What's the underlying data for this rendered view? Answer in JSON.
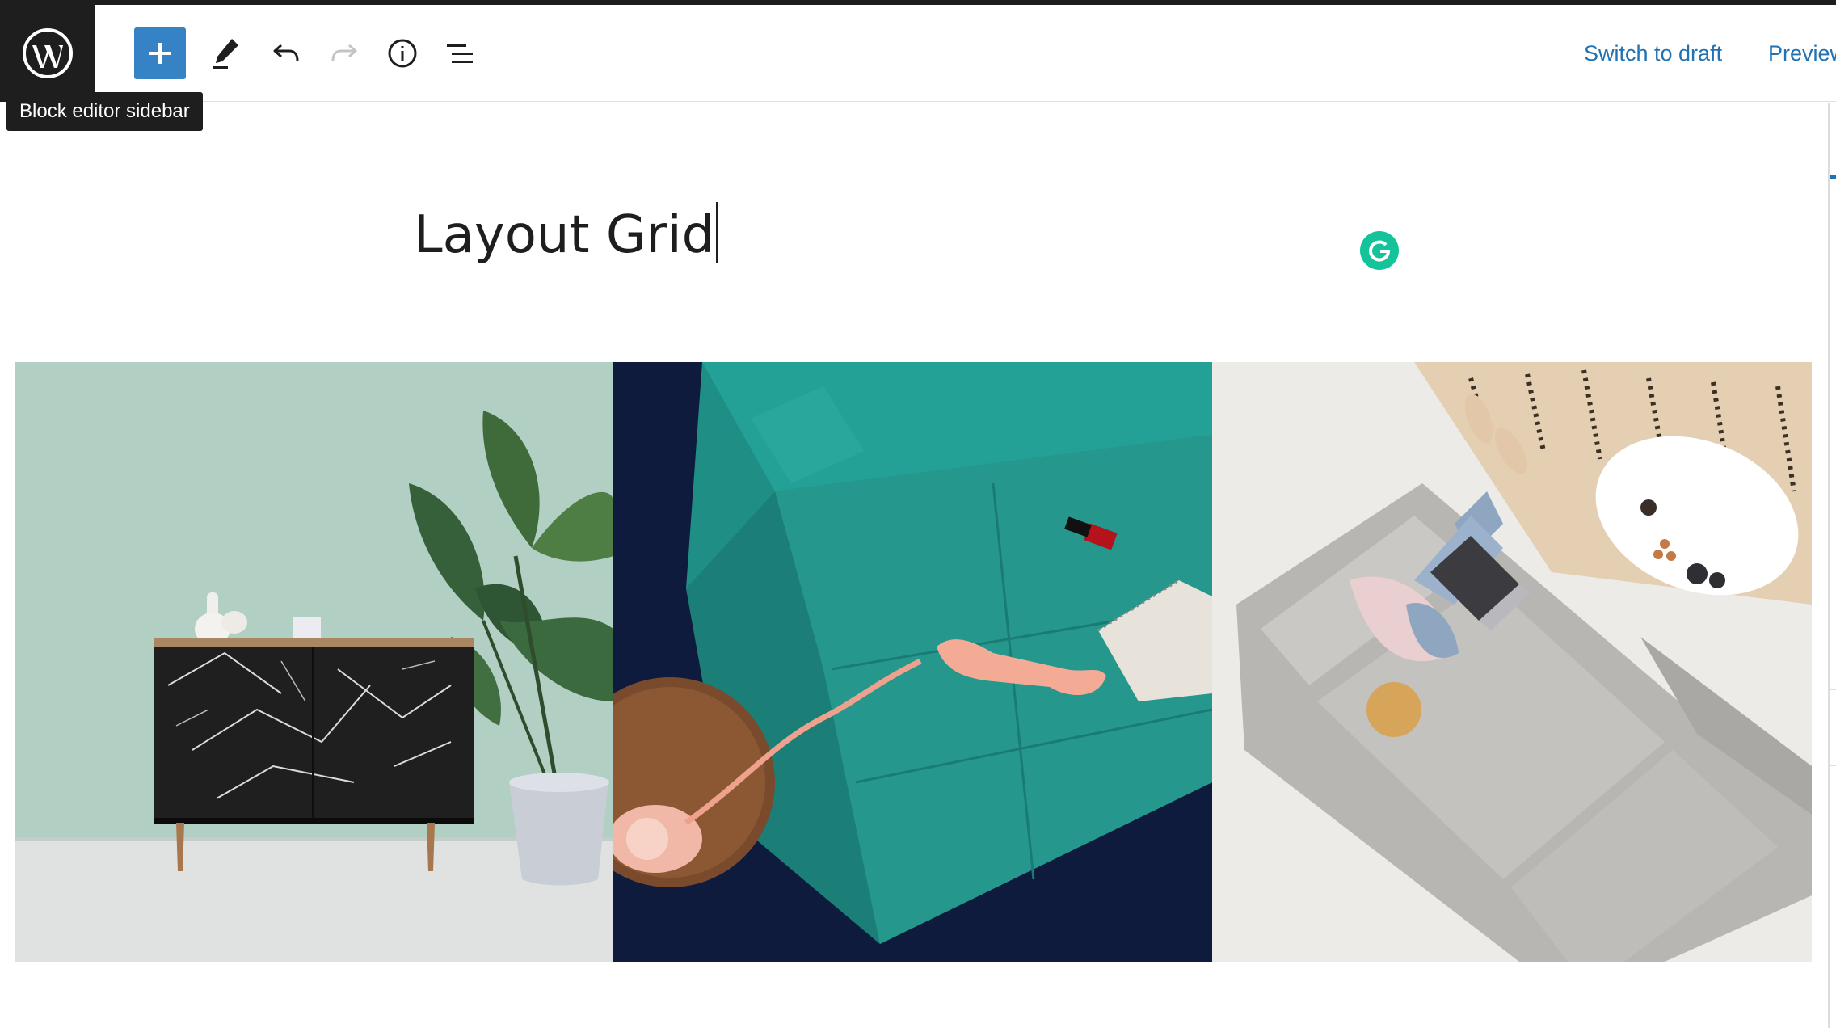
{
  "header": {
    "logo_icon": "wordpress-logo-icon",
    "tooltip": "Block editor sidebar",
    "tools": [
      {
        "name": "add-block",
        "icon": "plus-icon"
      },
      {
        "name": "tools",
        "icon": "pencil-icon"
      },
      {
        "name": "undo",
        "icon": "undo-icon"
      },
      {
        "name": "redo",
        "icon": "redo-icon"
      },
      {
        "name": "details",
        "icon": "info-icon"
      },
      {
        "name": "list-view",
        "icon": "list-view-icon"
      }
    ],
    "switch_to_draft_label": "Switch to draft",
    "preview_label": "Preview"
  },
  "editor": {
    "title": "Layout Grid",
    "grammarly_icon": "grammarly-icon"
  },
  "gallery": {
    "images": [
      {
        "name": "sideboard-with-plant-image"
      },
      {
        "name": "teal-sofa-with-telephone-image"
      },
      {
        "name": "woman-on-gray-sofa-image"
      }
    ]
  },
  "colors": {
    "accent": "#3582c4",
    "link": "#2271b1",
    "dark": "#1e1e1e",
    "grammarly": "#15c39a"
  }
}
